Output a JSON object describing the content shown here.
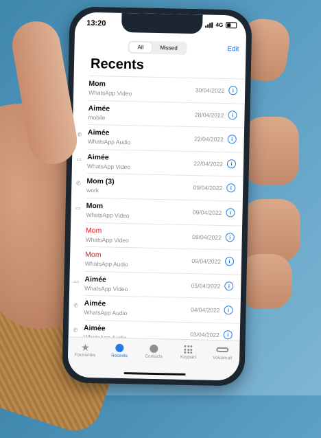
{
  "status_bar": {
    "time": "13:20",
    "network": "4G"
  },
  "segments": [
    {
      "label": "All",
      "active": true
    },
    {
      "label": "Missed",
      "active": false
    }
  ],
  "edit_label": "Edit",
  "title": "Recents",
  "calls": [
    {
      "name": "Mom",
      "type": "WhatsApp Video",
      "date": "30/04/2022",
      "icon": "",
      "missed": false
    },
    {
      "name": "Aimée",
      "type": "mobile",
      "date": "28/04/2022",
      "icon": "",
      "missed": false
    },
    {
      "name": "Aimée",
      "type": "WhatsApp Audio",
      "date": "22/04/2022",
      "icon": "phone-icon",
      "missed": false
    },
    {
      "name": "Aimée",
      "type": "WhatsApp Video",
      "date": "22/04/2022",
      "icon": "video-icon",
      "missed": false
    },
    {
      "name": "Mom (3)",
      "type": "work",
      "date": "09/04/2022",
      "icon": "phone-icon",
      "missed": false
    },
    {
      "name": "Mom",
      "type": "WhatsApp Video",
      "date": "09/04/2022",
      "icon": "video-icon",
      "missed": false
    },
    {
      "name": "Mom",
      "type": "WhatsApp Video",
      "date": "09/04/2022",
      "icon": "",
      "missed": true
    },
    {
      "name": "Mom",
      "type": "WhatsApp Audio",
      "date": "09/04/2022",
      "icon": "",
      "missed": true
    },
    {
      "name": "Aimée",
      "type": "WhatsApp Video",
      "date": "05/04/2022",
      "icon": "video-icon",
      "missed": false
    },
    {
      "name": "Aimée",
      "type": "WhatsApp Audio",
      "date": "04/04/2022",
      "icon": "phone-icon",
      "missed": false
    },
    {
      "name": "Aimée",
      "type": "WhatsApp Audio",
      "date": "03/04/2022",
      "icon": "phone-icon",
      "missed": false
    }
  ],
  "tabs": [
    {
      "label": "Favourites",
      "icon": "star-icon",
      "active": false
    },
    {
      "label": "Recents",
      "icon": "clock-icon",
      "active": true
    },
    {
      "label": "Contacts",
      "icon": "person-icon",
      "active": false
    },
    {
      "label": "Keypad",
      "icon": "keypad-icon",
      "active": false
    },
    {
      "label": "Voicemail",
      "icon": "voicemail-icon",
      "active": false
    }
  ],
  "colors": {
    "accent": "#1f7ae5",
    "missed": "#e0201b"
  }
}
